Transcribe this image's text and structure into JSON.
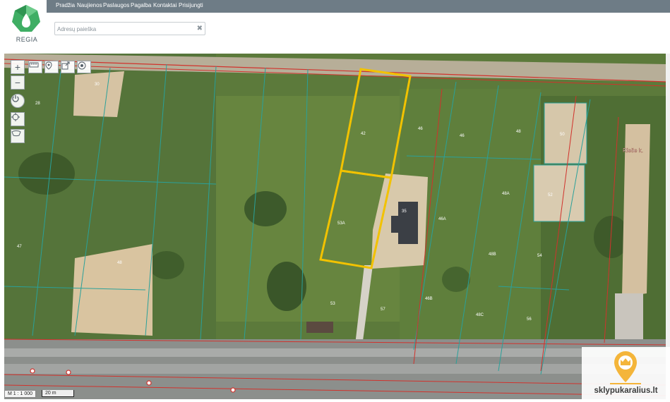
{
  "app": {
    "logo_text": "REGIA",
    "colors": {
      "nav_bg": "#6e7c86",
      "logo_green": "#3fae64",
      "parcel_outline": "#2aa19a",
      "selected_parcel": "#f2c200",
      "cadastre_red": "#d1322c"
    }
  },
  "nav": {
    "items": [
      "Pradžia",
      "Naujienos",
      "Paslaugos",
      "Pagalba",
      "Kontaktai",
      "Prisijungti"
    ]
  },
  "search": {
    "placeholder": "Adresų paieška",
    "value": "",
    "clear_icon": "close-icon"
  },
  "map": {
    "zoom_in_label": "+",
    "zoom_out_label": "−",
    "tools": [
      "ruler-icon",
      "marker-icon",
      "export-icon",
      "target-icon"
    ],
    "side_tools": [
      "power-icon",
      "locate-icon",
      "layers-icon"
    ],
    "place_label": "Rieše k.",
    "parcel_numbers": [
      "30",
      "28",
      "42",
      "46",
      "46",
      "48",
      "50",
      "52",
      "35",
      "53A",
      "46A",
      "48A",
      "47",
      "48",
      "48B",
      "54",
      "53",
      "57",
      "46B",
      "48C",
      "56"
    ],
    "scale_ratio": "M 1 : 1 000",
    "scale_bar": "20 m"
  },
  "watermark": {
    "text": "sklypukaralius.lt",
    "icon": "king-marker-icon"
  }
}
